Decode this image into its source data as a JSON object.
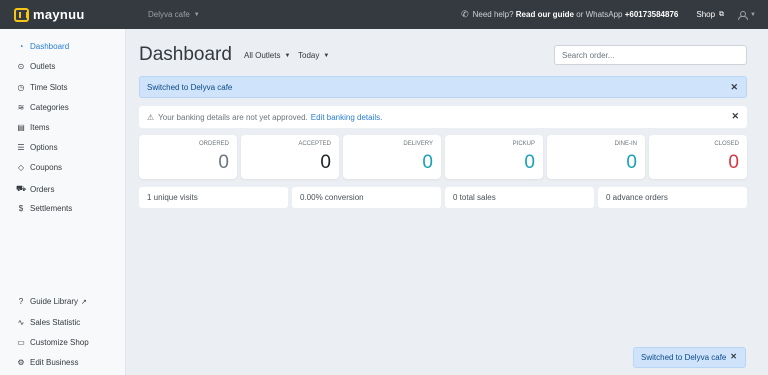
{
  "topbar": {
    "brand": "maynuu",
    "store": "Delyva cafe",
    "help_prefix": "Need help?",
    "guide_link": "Read our guide",
    "whatsapp_prefix": "or WhatsApp",
    "whatsapp_number": "+60173584876",
    "shop_label": "Shop"
  },
  "sidebar": {
    "items": [
      {
        "label": "Dashboard",
        "icon": "tachometer-icon"
      },
      {
        "label": "Outlets",
        "icon": "map-pin-icon"
      },
      {
        "label": "Time Slots",
        "icon": "clock-icon"
      },
      {
        "label": "Categories",
        "icon": "layers-icon"
      },
      {
        "label": "Items",
        "icon": "box-icon"
      },
      {
        "label": "Options",
        "icon": "sliders-icon"
      },
      {
        "label": "Coupons",
        "icon": "tag-icon"
      },
      {
        "label": "Orders",
        "icon": "cart-icon"
      },
      {
        "label": "Settlements",
        "icon": "dollar-icon"
      }
    ],
    "bottom": [
      {
        "label": "Guide Library",
        "icon": "question-icon"
      },
      {
        "label": "Sales Statistic",
        "icon": "chart-line-icon"
      },
      {
        "label": "Customize Shop",
        "icon": "brush-icon"
      },
      {
        "label": "Edit Business",
        "icon": "gear-icon"
      }
    ]
  },
  "main": {
    "title": "Dashboard",
    "outlet_filter": "All Outlets",
    "date_filter": "Today",
    "search_placeholder": "Search order...",
    "info_alert": "Switched to Delyva cafe",
    "warn_text": "Your banking details are not yet approved.",
    "warn_link": "Edit banking details.",
    "stats": [
      {
        "label": "ORDERED",
        "value": "0",
        "color": "#6c757d"
      },
      {
        "label": "ACCEPTED",
        "value": "0",
        "color": "#212529"
      },
      {
        "label": "DELIVERY",
        "value": "0",
        "color": "#17a2b8"
      },
      {
        "label": "PICKUP",
        "value": "0",
        "color": "#17a2b8"
      },
      {
        "label": "DINE-IN",
        "value": "0",
        "color": "#17a2b8"
      },
      {
        "label": "CLOSED",
        "value": "0",
        "color": "#dc3545"
      }
    ],
    "metrics": [
      "1 unique visits",
      "0.00% conversion",
      "0 total sales",
      "0 advance orders"
    ]
  },
  "toast": "Switched to Delyva cafe",
  "colors": {
    "accent": "#2a7fd4",
    "topbar": "#353a40",
    "brand_yellow": "#f5c518"
  }
}
